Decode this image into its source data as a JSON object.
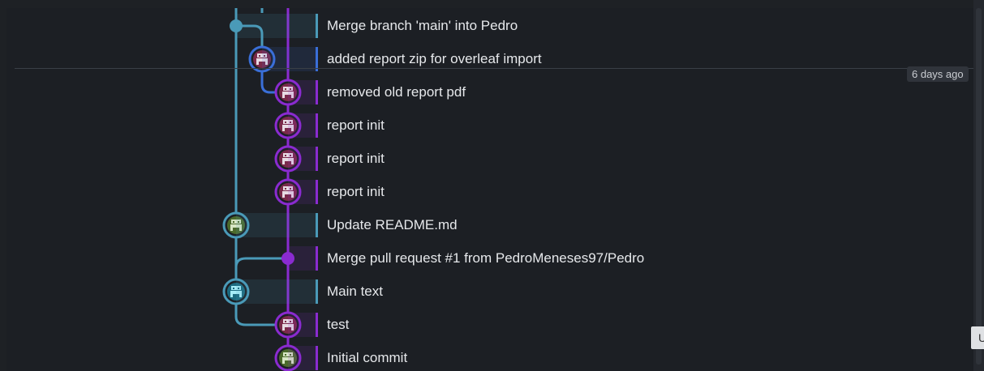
{
  "commits": [
    {
      "message": "Merge branch 'main' into Pedro",
      "branch_color": "#4a9ab8",
      "avatar": "none",
      "marker_color": "#4a9ab8"
    },
    {
      "message": "added report zip for overleaf import",
      "branch_color": "#3a6fd8",
      "avatar": "pixel-avatar-pink",
      "marker_color": "#3a6fd8"
    },
    {
      "message": "removed old report pdf",
      "branch_color": "#8a2bd0",
      "avatar": "pixel-avatar-pink",
      "marker_color": "#8a2bd0"
    },
    {
      "message": "report init",
      "branch_color": "#8a2bd0",
      "avatar": "pixel-avatar-pink",
      "marker_color": "#8a2bd0"
    },
    {
      "message": "report init",
      "branch_color": "#8a2bd0",
      "avatar": "pixel-avatar-pink",
      "marker_color": "#8a2bd0"
    },
    {
      "message": "report init",
      "branch_color": "#8a2bd0",
      "avatar": "pixel-avatar-pink",
      "marker_color": "#8a2bd0"
    },
    {
      "message": "Update README.md",
      "branch_color": "#4a9ab8",
      "avatar": "pixel-avatar-green",
      "marker_color": "#4a9ab8"
    },
    {
      "message": "Merge pull request #1 from PedroMeneses97/Pedro",
      "branch_color": "#8a2bd0",
      "avatar": "none",
      "marker_color": "#8a2bd0"
    },
    {
      "message": "Main text",
      "branch_color": "#4a9ab8",
      "avatar": "pixel-avatar-cyan",
      "marker_color": "#4a9ab8"
    },
    {
      "message": "test",
      "branch_color": "#8a2bd0",
      "avatar": "pixel-avatar-pink",
      "marker_color": "#8a2bd0"
    },
    {
      "message": "Initial commit",
      "branch_color": "#8a2bd0",
      "avatar": "pixel-avatar-green",
      "marker_color": "#8a2bd0"
    }
  ],
  "date_divider": {
    "label": "6 days ago"
  },
  "tooltip": {
    "text": "U"
  },
  "colors": {
    "background": "#1c1f24",
    "branch_main": "#4a9ab8",
    "branch_pedro": "#8a2bd0",
    "branch_report": "#3a6fd8"
  }
}
